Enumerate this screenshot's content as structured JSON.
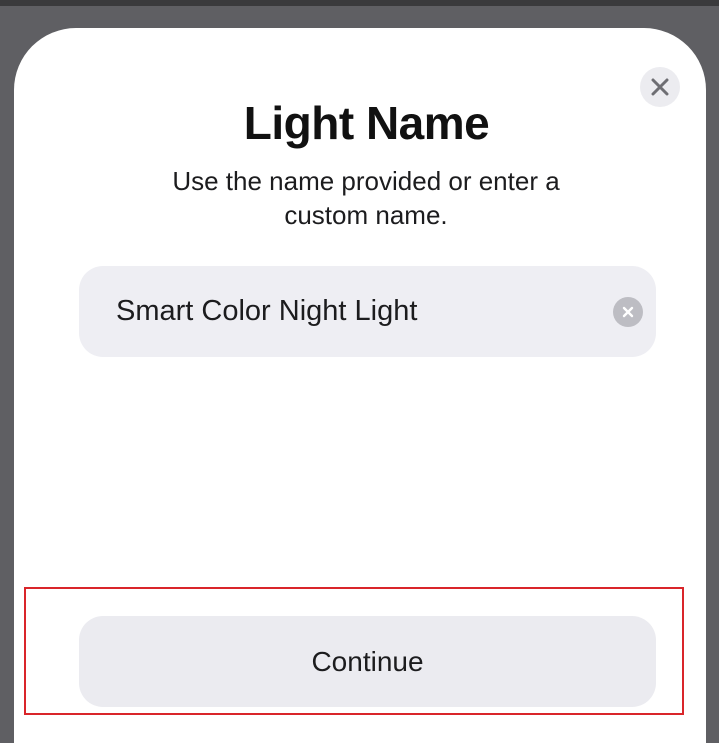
{
  "dialog": {
    "title": "Light Name",
    "subtitle": "Use the name provided or enter a custom name.",
    "close_icon": "close-icon"
  },
  "name_field": {
    "value": "Smart Color Night Light",
    "placeholder": "",
    "clear_icon": "clear-icon"
  },
  "actions": {
    "continue_label": "Continue"
  },
  "colors": {
    "highlight": "#d9252a",
    "field_background": "#eeeef3",
    "text": "#1c1c1e"
  }
}
